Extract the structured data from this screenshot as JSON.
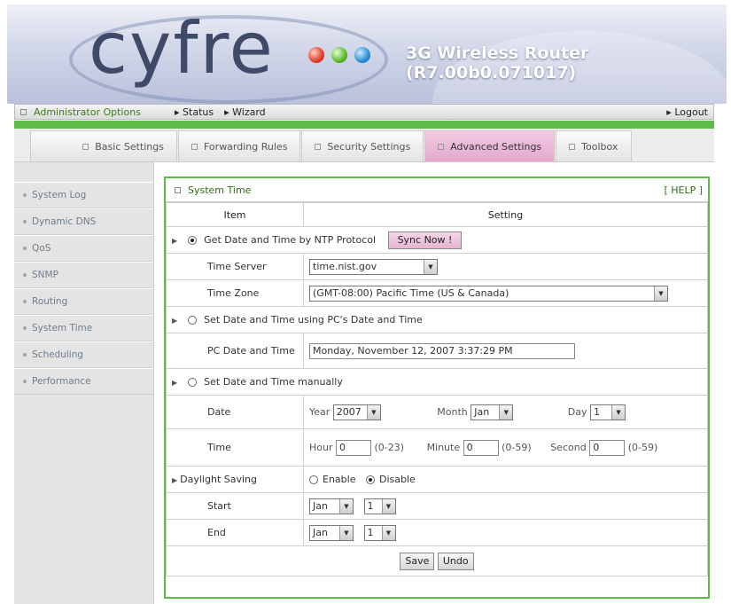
{
  "header": {
    "logo_text": "cyfre",
    "product": "3G Wireless Router (R7.00b0.071017)"
  },
  "topnav": {
    "admin": "Administrator Options",
    "status": "Status",
    "wizard": "Wizard",
    "logout": "Logout"
  },
  "tabs": [
    {
      "label": "Basic Settings"
    },
    {
      "label": "Forwarding Rules"
    },
    {
      "label": "Security Settings"
    },
    {
      "label": "Advanced Settings",
      "active": true
    },
    {
      "label": "Toolbox"
    }
  ],
  "sidebar": {
    "items": [
      {
        "label": "System Log"
      },
      {
        "label": "Dynamic DNS"
      },
      {
        "label": "QoS"
      },
      {
        "label": "SNMP"
      },
      {
        "label": "Routing"
      },
      {
        "label": "System Time"
      },
      {
        "label": "Scheduling"
      },
      {
        "label": "Performance"
      }
    ]
  },
  "panel": {
    "title": "System Time",
    "help": "[ HELP ]",
    "col_item": "Item",
    "col_setting": "Setting",
    "ntp": {
      "label": "Get Date and Time by NTP Protocol",
      "sync_button": "Sync Now !"
    },
    "time_server": {
      "label": "Time Server",
      "value": "time.nist.gov"
    },
    "time_zone": {
      "label": "Time Zone",
      "value": "(GMT-08:00) Pacific Time (US & Canada)"
    },
    "pc": {
      "label": "Set Date and Time using PC's Date and Time",
      "date_label": "PC Date and Time",
      "date_value": "Monday, November 12, 2007 3:37:29 PM"
    },
    "manual": {
      "label": "Set Date and Time manually"
    },
    "date": {
      "label": "Date",
      "year_label": "Year",
      "year": "2007",
      "month_label": "Month",
      "month": "Jan",
      "day_label": "Day",
      "day": "1"
    },
    "time": {
      "label": "Time",
      "hour_label": "Hour",
      "hour": "0",
      "hour_range": "(0-23)",
      "minute_label": "Minute",
      "minute": "0",
      "minute_range": "(0-59)",
      "second_label": "Second",
      "second": "0",
      "second_range": "(0-59)"
    },
    "dst": {
      "label": "Daylight Saving",
      "enable": "Enable",
      "disable": "Disable",
      "start_label": "Start",
      "start_month": "Jan",
      "start_day": "1",
      "end_label": "End",
      "end_month": "Jan",
      "end_day": "1"
    },
    "save": "Save",
    "undo": "Undo"
  },
  "colors": {
    "accent_green": "#5dbb46",
    "active_tab": "#e6b4d2",
    "title_green": "#2f6e17"
  }
}
